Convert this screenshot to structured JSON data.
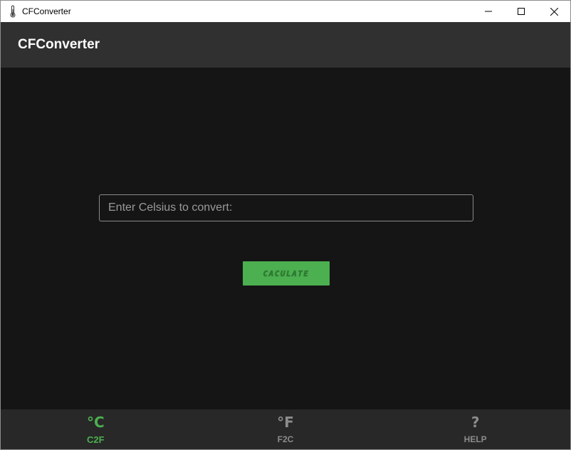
{
  "window": {
    "title": "CFConverter",
    "icon": "thermometer-icon",
    "controls": [
      "minimize-icon",
      "maximize-icon",
      "close-icon"
    ]
  },
  "appbar": {
    "title": "CFConverter"
  },
  "main": {
    "input": {
      "value": "",
      "placeholder": "Enter Celsius to convert:"
    },
    "button_label": "CACULATE"
  },
  "bottom_nav": {
    "items": [
      {
        "icon_text": "°C",
        "label": "C2F",
        "active": true
      },
      {
        "icon_text": "°F",
        "label": "F2C",
        "active": false
      },
      {
        "icon_text": "?",
        "label": "HELP",
        "active": false
      }
    ]
  },
  "colors": {
    "accent": "#4caf50",
    "background": "#151515",
    "appbar": "#303030",
    "bottom_nav": "#282828",
    "inactive": "#8c8c8c"
  }
}
